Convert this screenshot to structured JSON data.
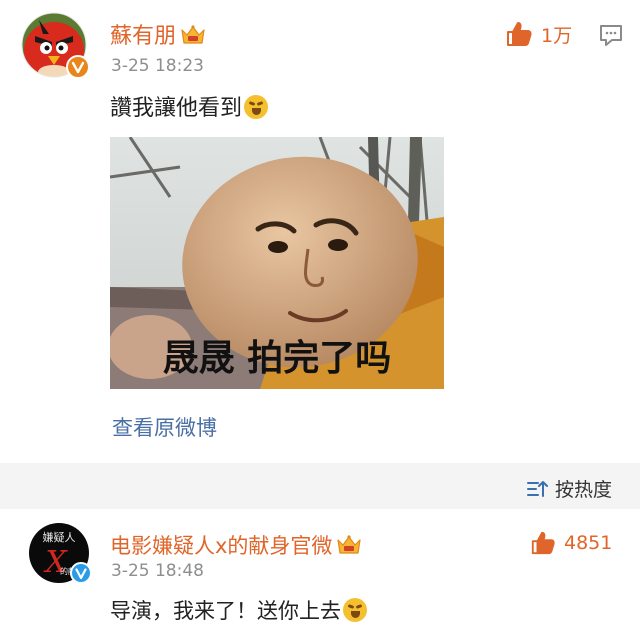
{
  "comment1": {
    "username": "蘇有朋",
    "timestamp": "3-25 18:23",
    "text": "讚我讓他看到",
    "like_count": "1万",
    "image_caption": "晟晟 拍完了吗",
    "view_original": "查看原微博"
  },
  "sort": {
    "label": "按热度"
  },
  "comment2": {
    "username": "电影嫌疑人x的献身官微",
    "timestamp": "3-25 18:48",
    "text": "导演，我来了！送你上去",
    "like_count": "4851",
    "avatar_text_top": "嫌疑人",
    "avatar_letter": "X",
    "avatar_text_bottom": "的献身"
  },
  "colors": {
    "accent": "#e0652a",
    "verified_badge": "#e8861c",
    "verified_blue": "#2b9be8",
    "link": "#4a6fa5",
    "sort_icon": "#3a6fb0"
  },
  "icons": {
    "like": "thumbs-up-icon",
    "comment": "comment-icon",
    "vip": "vip-crown-icon",
    "sort": "sort-icon"
  }
}
